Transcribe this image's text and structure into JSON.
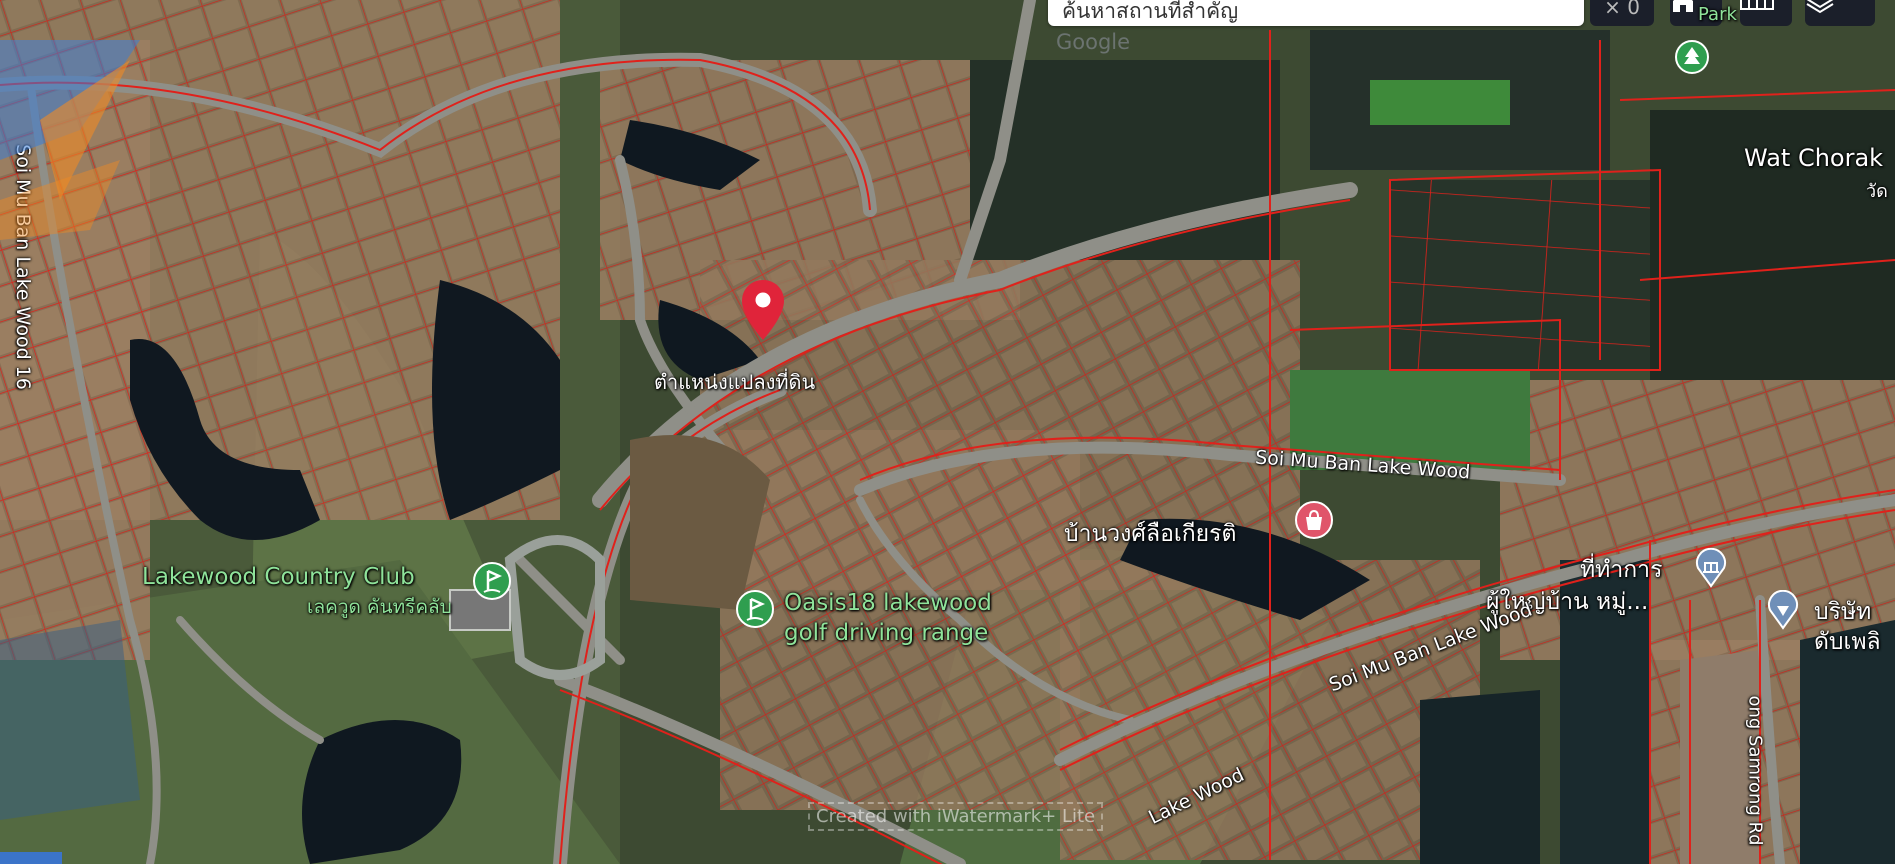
{
  "search": {
    "value": "ค้นหาสถานที่สำคัญ"
  },
  "controls": {
    "clear_label": "× 0",
    "home_icon": "home-icon",
    "grid_icon": "grid-icon",
    "layers_icon": "layers-icon"
  },
  "pin_label": "ตำแหน่งแปลงที่ดิน",
  "places": {
    "lakewood_cc_en": "Lakewood Country Club",
    "lakewood_cc_th": "เลควูด คันทรีคลับ",
    "oasis_line1": "Oasis18 lakewood",
    "oasis_line2": "golf driving range",
    "baan_wong": "บ้านวงศ์ลือเกียรติ",
    "office_line1": "ที่ทำการ",
    "office_line2": "ผู้ใหญ่บ้าน หมู่...",
    "wat": "Wat Chorak",
    "wat_th": "วัด",
    "park": "Park",
    "right_thai1": "บริษัท",
    "right_thai2": "ดับเพลิ"
  },
  "roads": {
    "soi_16": "Soi Mu Ban Lake Wood 16",
    "soi_upper": "Soi Mu Ban Lake Wood",
    "soi_lower": "Soi Mu Ban Lake Wood",
    "lake_wood_bottom": "Lake Wood",
    "samrong": "ong Samrong Rd"
  },
  "watermark": "Created with iWatermark+ Lite",
  "google": "Google",
  "colors": {
    "parcel": "#e0211b",
    "pin": "#e0243a",
    "green_poi": "#2f9e4f",
    "ctrl_bg": "#1b1f2a"
  }
}
